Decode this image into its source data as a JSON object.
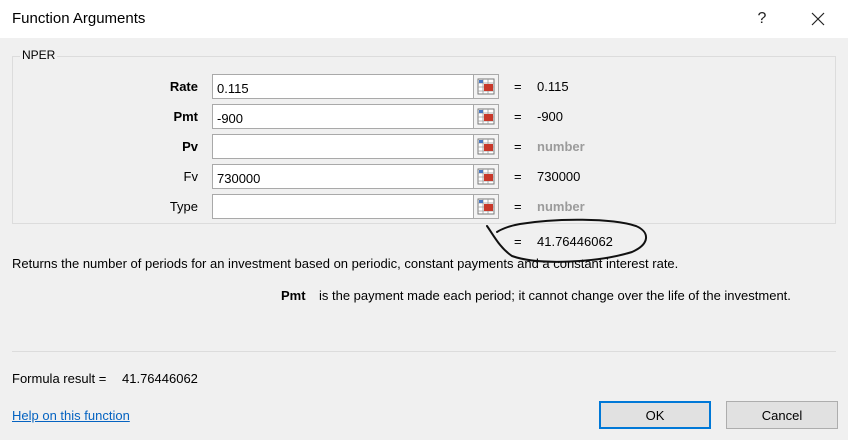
{
  "dialog": {
    "title": "Function Arguments",
    "help_glyph": "?",
    "function_name": "NPER"
  },
  "arguments": [
    {
      "label": "Rate",
      "value": "0.115",
      "result": "0.115"
    },
    {
      "label": "Pmt",
      "value": "-900",
      "result": "-900"
    },
    {
      "label": "Pv",
      "value": "",
      "result": "number"
    },
    {
      "label": "Fv",
      "value": "730000",
      "result": "730000"
    },
    {
      "label": "Type",
      "value": "",
      "result": "number"
    }
  ],
  "equals": "=",
  "result_value": "41.76446062",
  "description": "Returns the number of periods for an investment based on periodic, constant payments and a constant interest rate.",
  "arg_help": {
    "name": "Pmt",
    "text": "is the payment made each period; it cannot change over the life of the investment."
  },
  "formula_result": {
    "label": "Formula result =",
    "value": "41.76446062"
  },
  "help_link": "Help on this function",
  "buttons": {
    "ok": "OK",
    "cancel": "Cancel"
  },
  "colors": {
    "link": "#0563c1",
    "ok_border": "#0078d7",
    "hint": "#9b9b9b"
  }
}
